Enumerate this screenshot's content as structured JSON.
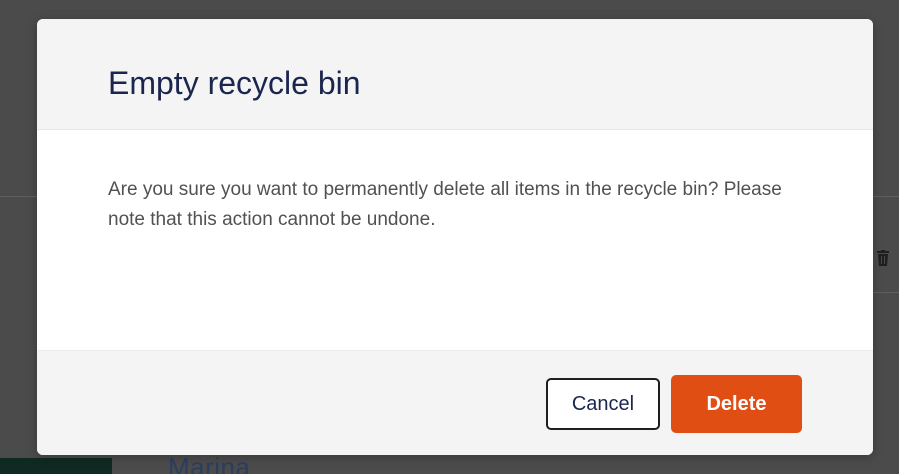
{
  "dialog": {
    "title": "Empty recycle bin",
    "message": "Are you sure you want to permanently delete all items in the recycle bin? Please note that this action cannot be undone.",
    "cancel_label": "Cancel",
    "delete_label": "Delete"
  },
  "background": {
    "visible_name_fragment": "Marina",
    "row_action_icon": "trash-icon"
  },
  "colors": {
    "title_text": "#1b264f",
    "body_text": "#515151",
    "delete_button": "#e04e13",
    "overlay": "#4b4b4b",
    "header_footer_bg": "#f4f4f4"
  }
}
